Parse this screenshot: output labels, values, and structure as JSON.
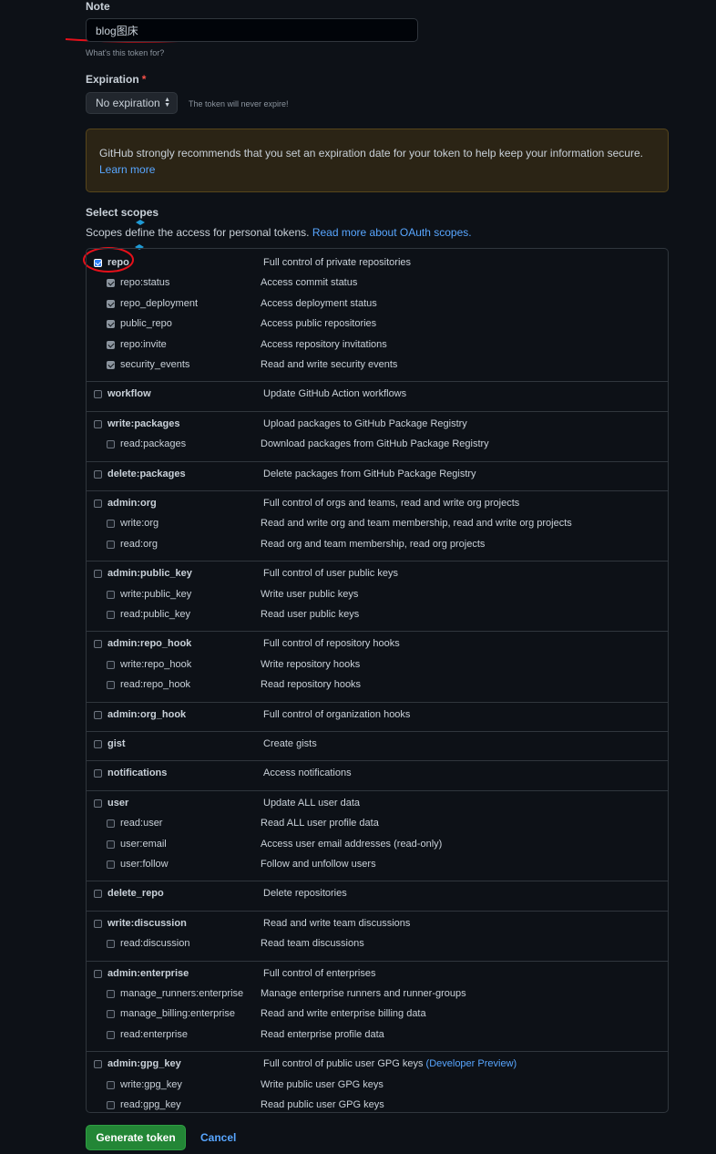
{
  "note": {
    "label": "Note",
    "value": "blog图床",
    "hint": "What's this token for?"
  },
  "expiration": {
    "label": "Expiration",
    "required_mark": "*",
    "selected": "No expiration",
    "note": "The token will never expire!"
  },
  "warning": {
    "text": "GitHub strongly recommends that you set an expiration date for your token to help keep your information secure.",
    "link": "Learn more"
  },
  "scopes": {
    "title": "Select scopes",
    "description": "Scopes define the access for personal tokens.",
    "link": "Read more about OAuth scopes.",
    "groups": [
      {
        "name": "repo",
        "desc": "Full control of private repositories",
        "checked": true,
        "subs": [
          {
            "name": "repo:status",
            "desc": "Access commit status",
            "checked": true
          },
          {
            "name": "repo_deployment",
            "desc": "Access deployment status",
            "checked": true
          },
          {
            "name": "public_repo",
            "desc": "Access public repositories",
            "checked": true
          },
          {
            "name": "repo:invite",
            "desc": "Access repository invitations",
            "checked": true
          },
          {
            "name": "security_events",
            "desc": "Read and write security events",
            "checked": true
          }
        ]
      },
      {
        "name": "workflow",
        "desc": "Update GitHub Action workflows",
        "checked": false,
        "subs": []
      },
      {
        "name": "write:packages",
        "desc": "Upload packages to GitHub Package Registry",
        "checked": false,
        "subs": [
          {
            "name": "read:packages",
            "desc": "Download packages from GitHub Package Registry",
            "checked": false
          }
        ]
      },
      {
        "name": "delete:packages",
        "desc": "Delete packages from GitHub Package Registry",
        "checked": false,
        "subs": []
      },
      {
        "name": "admin:org",
        "desc": "Full control of orgs and teams, read and write org projects",
        "checked": false,
        "subs": [
          {
            "name": "write:org",
            "desc": "Read and write org and team membership, read and write org projects",
            "checked": false
          },
          {
            "name": "read:org",
            "desc": "Read org and team membership, read org projects",
            "checked": false
          }
        ]
      },
      {
        "name": "admin:public_key",
        "desc": "Full control of user public keys",
        "checked": false,
        "subs": [
          {
            "name": "write:public_key",
            "desc": "Write user public keys",
            "checked": false
          },
          {
            "name": "read:public_key",
            "desc": "Read user public keys",
            "checked": false
          }
        ]
      },
      {
        "name": "admin:repo_hook",
        "desc": "Full control of repository hooks",
        "checked": false,
        "subs": [
          {
            "name": "write:repo_hook",
            "desc": "Write repository hooks",
            "checked": false
          },
          {
            "name": "read:repo_hook",
            "desc": "Read repository hooks",
            "checked": false
          }
        ]
      },
      {
        "name": "admin:org_hook",
        "desc": "Full control of organization hooks",
        "checked": false,
        "subs": []
      },
      {
        "name": "gist",
        "desc": "Create gists",
        "checked": false,
        "subs": []
      },
      {
        "name": "notifications",
        "desc": "Access notifications",
        "checked": false,
        "subs": []
      },
      {
        "name": "user",
        "desc": "Update ALL user data",
        "checked": false,
        "subs": [
          {
            "name": "read:user",
            "desc": "Read ALL user profile data",
            "checked": false
          },
          {
            "name": "user:email",
            "desc": "Access user email addresses (read-only)",
            "checked": false
          },
          {
            "name": "user:follow",
            "desc": "Follow and unfollow users",
            "checked": false
          }
        ]
      },
      {
        "name": "delete_repo",
        "desc": "Delete repositories",
        "checked": false,
        "subs": []
      },
      {
        "name": "write:discussion",
        "desc": "Read and write team discussions",
        "checked": false,
        "subs": [
          {
            "name": "read:discussion",
            "desc": "Read team discussions",
            "checked": false
          }
        ]
      },
      {
        "name": "admin:enterprise",
        "desc": "Full control of enterprises",
        "checked": false,
        "subs": [
          {
            "name": "manage_runners:enterprise",
            "desc": "Manage enterprise runners and runner-groups",
            "checked": false
          },
          {
            "name": "manage_billing:enterprise",
            "desc": "Read and write enterprise billing data",
            "checked": false
          },
          {
            "name": "read:enterprise",
            "desc": "Read enterprise profile data",
            "checked": false
          }
        ]
      },
      {
        "name": "admin:gpg_key",
        "desc": "Full control of public user GPG keys",
        "desc_link": "(Developer Preview)",
        "checked": false,
        "subs": [
          {
            "name": "write:gpg_key",
            "desc": "Write public user GPG keys",
            "checked": false
          },
          {
            "name": "read:gpg_key",
            "desc": "Read public user GPG keys",
            "checked": false
          }
        ]
      }
    ]
  },
  "actions": {
    "generate": "Generate token",
    "cancel": "Cancel"
  },
  "colors": {
    "background": "#0d1117",
    "accent_green": "#238636",
    "link_blue": "#58a6ff",
    "annotation_red": "#e5101a"
  }
}
